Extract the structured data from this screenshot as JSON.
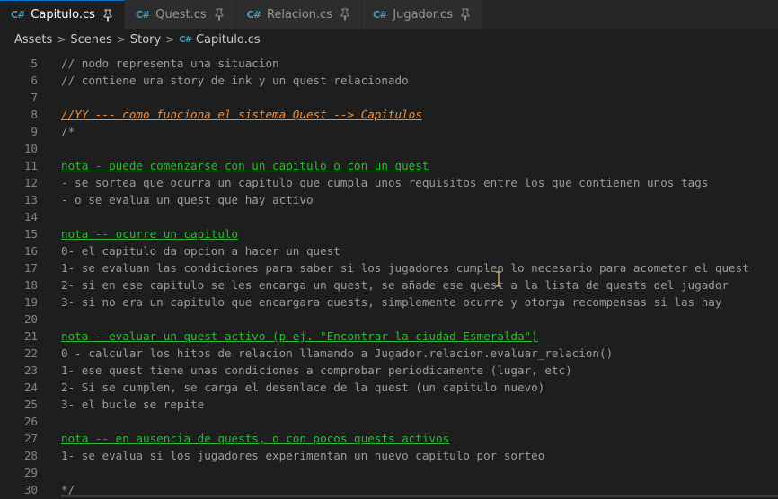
{
  "tabs": [
    {
      "label": "Capitulo.cs",
      "icon": "csharp-icon",
      "active": true
    },
    {
      "label": "Quest.cs",
      "icon": "csharp-icon",
      "active": false
    },
    {
      "label": "Relacion.cs",
      "icon": "csharp-icon",
      "active": false
    },
    {
      "label": "Jugador.cs",
      "icon": "csharp-icon",
      "active": false
    }
  ],
  "icon_glyph": "C#",
  "breadcrumb": {
    "items": [
      "Assets",
      "Scenes",
      "Story"
    ],
    "file": "Capitulo.cs",
    "separator": ">"
  },
  "colors": {
    "comment": "#9b9b9b",
    "yy_tag": "#ff8c2e",
    "nota_tag": "#2fb836",
    "line_number": "#858585",
    "background": "#1e1e1e"
  },
  "lines": [
    {
      "n": "5",
      "text": "// nodo representa una situacion",
      "style": "comment"
    },
    {
      "n": "6",
      "text": "// contiene una story de ink y un quest relacionado",
      "style": "comment"
    },
    {
      "n": "7",
      "text": "",
      "style": "comment"
    },
    {
      "n": "8",
      "text": "//YY --- como funciona el sistema Quest --> Capitulos",
      "style": "yy"
    },
    {
      "n": "9",
      "text": "/*",
      "style": "comment"
    },
    {
      "n": "10",
      "text": "",
      "style": "comment"
    },
    {
      "n": "11",
      "text": "nota - puede comenzarse con un capitulo o con un quest",
      "style": "nota"
    },
    {
      "n": "12",
      "text": "- se sortea que ocurra un capitulo que cumpla unos requisitos entre los que contienen unos tags",
      "style": "plain"
    },
    {
      "n": "13",
      "text": "- o se evalua un quest que hay activo",
      "style": "plain"
    },
    {
      "n": "14",
      "text": "",
      "style": "plain"
    },
    {
      "n": "15",
      "text": "nota -- ocurre un capitulo",
      "style": "nota"
    },
    {
      "n": "16",
      "text": "0- el capitulo da opcion a hacer un quest",
      "style": "plain"
    },
    {
      "n": "17",
      "text": "1- se evaluan las condiciones para saber si los jugadores cumplen lo necesario para acometer el quest",
      "style": "plain"
    },
    {
      "n": "18",
      "text": "2- si en ese capitulo se les encarga un quest, se añade ese quest a la lista de quests del jugador",
      "style": "plain"
    },
    {
      "n": "19",
      "text": "3- si no era un capitulo que encargara quests, simplemente ocurre y otorga recompensas si las hay",
      "style": "plain"
    },
    {
      "n": "20",
      "text": "",
      "style": "plain"
    },
    {
      "n": "21",
      "text": "nota - evaluar un quest activo (p ej. \"Encontrar la ciudad Esmeralda\")",
      "style": "nota"
    },
    {
      "n": "22",
      "text": "0 - calcular los hitos de relacion llamando a Jugador.relacion.evaluar_relacion()",
      "style": "plain"
    },
    {
      "n": "23",
      "text": "1- ese quest tiene unas condiciones a comprobar periodicamente (lugar, etc)",
      "style": "plain"
    },
    {
      "n": "24",
      "text": "2- Si se cumplen, se carga el desenlace de la quest (un capitulo nuevo)",
      "style": "plain"
    },
    {
      "n": "25",
      "text": "3- el bucle se repite",
      "style": "plain"
    },
    {
      "n": "26",
      "text": "",
      "style": "plain"
    },
    {
      "n": "27",
      "text": "nota -- en ausencia de quests, o con pocos quests activos",
      "style": "nota"
    },
    {
      "n": "28",
      "text": "1- se evalua si los jugadores experimentan un nuevo capitulo por sorteo",
      "style": "plain"
    },
    {
      "n": "29",
      "text": "",
      "style": "plain"
    },
    {
      "n": "30",
      "text": "*/",
      "style": "comment"
    }
  ]
}
